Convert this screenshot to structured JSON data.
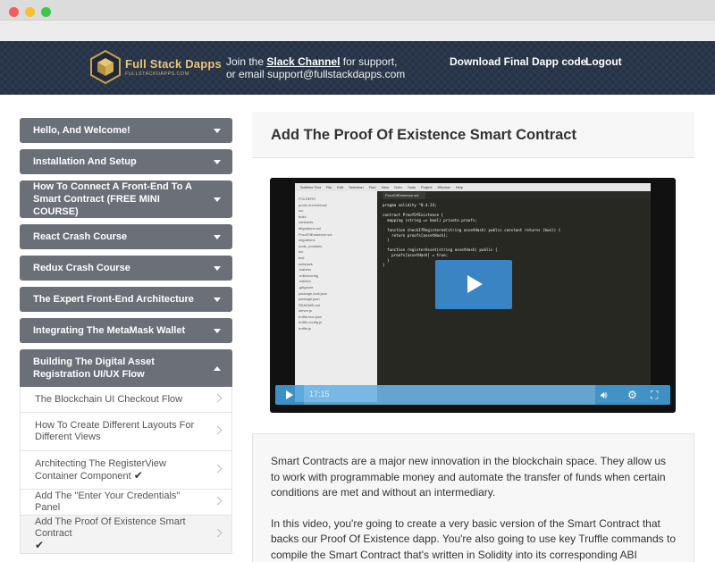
{
  "header": {
    "logo_title": "Full Stack Dapps",
    "logo_sub": "FULLSTACKDAPPS.COM",
    "support_prefix": "Join the ",
    "support_link": "Slack Channel",
    "support_suffix": " for support,",
    "support_email": "or email support@fullstackdapps.com",
    "download": "Download Final Dapp code",
    "logout": "Logout",
    "accent_color": "#e8c673"
  },
  "sidebar": {
    "sections": [
      {
        "label": "Hello, And Welcome!"
      },
      {
        "label": "Installation And Setup"
      },
      {
        "label": "How To Connect A Front-End To A Smart Contract (FREE MINI COURSE)"
      },
      {
        "label": "React Crash Course"
      },
      {
        "label": "Redux Crash Course"
      },
      {
        "label": "The Expert Front-End Architecture"
      },
      {
        "label": "Integrating The MetaMask Wallet"
      },
      {
        "label": "Building The Digital Asset Registration UI/UX Flow"
      }
    ],
    "lessons": [
      {
        "label": "The Blockchain UI Checkout Flow",
        "check": ""
      },
      {
        "label": "How To Create Different Layouts For Different Views",
        "check": ""
      },
      {
        "label": "Architecting The RegisterView Container Component",
        "check": "✔"
      },
      {
        "label": "Add The \"Enter Your Credentials\" Panel",
        "check": ""
      },
      {
        "label": "Add The Proof Of Existence Smart Contract",
        "check": "✔"
      }
    ]
  },
  "main": {
    "title": "Add The Proof Of Existence Smart Contract",
    "video": {
      "time": "17:15",
      "progress": 0.0,
      "editor_title": "ProofOfExistence.sol — proof-of-existence",
      "tab": "ProofOfExistence.sol",
      "menu": [
        "Sublime Text",
        "File",
        "Edit",
        "Selection",
        "Find",
        "View",
        "Goto",
        "Tools",
        "Project",
        "Window",
        "Help"
      ],
      "tree": [
        "FOLDERS",
        "proof-of-existence",
        "src",
        "build",
        "contracts",
        "Migrations.sol",
        "ProofOfExistence.sol",
        "migrations",
        "node_modules",
        "src",
        "test",
        "webpack",
        ".babelrc",
        ".editorconfig",
        ".eslintrc",
        ".gitignore",
        "package-lock.json",
        "package.json",
        "README.md",
        "server.js",
        "truffle-box.json",
        "truffle-config.js",
        "truffle.js"
      ],
      "code": [
        "pragma solidity ^0.4.24;",
        "",
        "contract ProofOfExistence {",
        "  mapping (string => bool) private proofs;",
        "",
        "  function checkIfRegistered(string assetHash) public constant returns (bool) {",
        "    return proofs[assetHash];",
        "  }",
        "",
        "  function registerAsset(string assetHash) public {",
        "    proofs[assetHash] = true;",
        "  }",
        "}"
      ]
    },
    "description": {
      "p1": "Smart Contracts are a major new innovation in the blockchain space.  They allow us to work with programmable money and automate the transfer of funds when certain conditions are met and without an intermediary.",
      "p2": "In this video, you're going to create a very basic version of the Smart Contract that backs our Proof Of Existence dapp.  You're also going to use key Truffle commands to compile the Smart Contract that's written in Solidity into its corresponding ABI"
    }
  }
}
